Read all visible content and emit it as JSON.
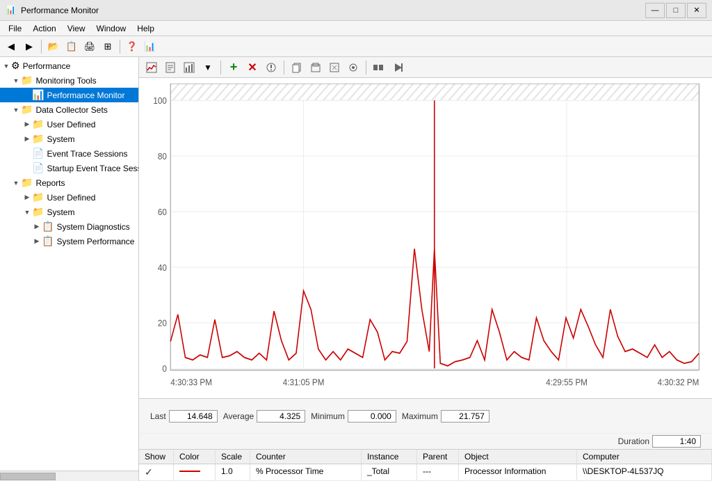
{
  "window": {
    "title": "Performance Monitor",
    "icon": "📊"
  },
  "titlebar": {
    "minimize": "—",
    "maximize": "□",
    "close": "✕"
  },
  "menu": {
    "items": [
      "File",
      "Action",
      "View",
      "Window",
      "Help"
    ]
  },
  "toolbar": {
    "buttons": [
      "←",
      "→",
      "📁",
      "📋",
      "🖨",
      "⊞",
      "❓",
      "📊"
    ]
  },
  "graph_toolbar": {
    "buttons": [
      {
        "icon": "⊞",
        "name": "view-graph-btn"
      },
      {
        "icon": "📋",
        "name": "view-report-btn"
      },
      {
        "icon": "⊡",
        "name": "view-histogram-btn"
      },
      {
        "icon": "▼",
        "name": "view-dropdown-btn"
      },
      {
        "icon": "+",
        "name": "add-counter-btn",
        "green": true
      },
      {
        "icon": "✕",
        "name": "delete-counter-btn",
        "red": true
      },
      {
        "icon": "✎",
        "name": "properties-btn"
      },
      {
        "icon": "📋",
        "name": "copy-btn"
      },
      {
        "icon": "📄",
        "name": "paste-btn"
      },
      {
        "icon": "⊞",
        "name": "clear-btn"
      },
      {
        "icon": "🔍",
        "name": "highlight-btn"
      },
      {
        "icon": "⏸",
        "name": "freeze-btn"
      },
      {
        "icon": "▶",
        "name": "update-btn"
      }
    ]
  },
  "tree": {
    "root": {
      "label": "Performance",
      "icon": "⚙",
      "expanded": true
    },
    "items": [
      {
        "label": "Monitoring Tools",
        "icon": "📁",
        "level": 1,
        "expanded": true,
        "id": "monitoring-tools"
      },
      {
        "label": "Performance Monitor",
        "icon": "📊",
        "level": 2,
        "selected": true,
        "id": "performance-monitor"
      },
      {
        "label": "Data Collector Sets",
        "icon": "📁",
        "level": 1,
        "expanded": true,
        "id": "data-collector-sets"
      },
      {
        "label": "User Defined",
        "icon": "📁",
        "level": 2,
        "id": "user-defined-1"
      },
      {
        "label": "System",
        "icon": "📁",
        "level": 2,
        "id": "system-1"
      },
      {
        "label": "Event Trace Sessions",
        "icon": "📄",
        "level": 2,
        "id": "event-trace"
      },
      {
        "label": "Startup Event Trace Sess…",
        "icon": "📄",
        "level": 2,
        "id": "startup-event-trace"
      },
      {
        "label": "Reports",
        "icon": "📁",
        "level": 1,
        "expanded": true,
        "id": "reports"
      },
      {
        "label": "User Defined",
        "icon": "📁",
        "level": 2,
        "id": "user-defined-2"
      },
      {
        "label": "System",
        "icon": "📁",
        "level": 2,
        "expanded": true,
        "id": "system-2"
      },
      {
        "label": "System Diagnostics",
        "icon": "📋",
        "level": 3,
        "id": "system-diagnostics"
      },
      {
        "label": "System Performance",
        "icon": "📋",
        "level": 3,
        "id": "system-performance"
      }
    ]
  },
  "chart": {
    "y_max": 100,
    "y_labels": [
      100,
      80,
      60,
      40,
      20,
      0
    ],
    "x_labels": [
      "4:30:33 PM",
      "4:31:05 PM",
      "4:29:55 PM",
      "4:30:32 PM"
    ]
  },
  "stats": {
    "last_label": "Last",
    "last_value": "14.648",
    "average_label": "Average",
    "average_value": "4.325",
    "minimum_label": "Minimum",
    "minimum_value": "0.000",
    "maximum_label": "Maximum",
    "maximum_value": "21.757",
    "duration_label": "Duration",
    "duration_value": "1:40"
  },
  "counter_table": {
    "headers": [
      "Show",
      "Color",
      "Scale",
      "Counter",
      "Instance",
      "Parent",
      "Object",
      "Computer"
    ],
    "rows": [
      {
        "show": true,
        "color": "#cc0000",
        "scale": "1.0",
        "counter": "% Processor Time",
        "instance": "_Total",
        "parent": "---",
        "object": "Processor Information",
        "computer": "\\\\DESKTOP-4L537JQ"
      }
    ]
  }
}
